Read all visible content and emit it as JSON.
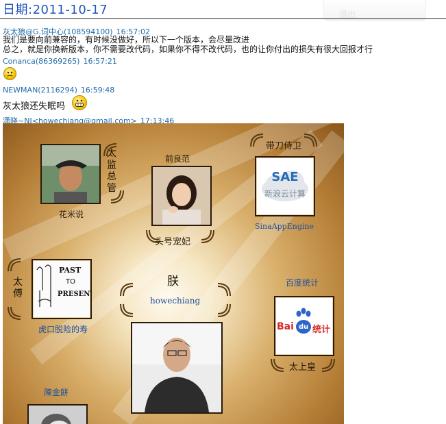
{
  "header": {
    "date_label": "日期:2011-10-17",
    "exit_button": "退出"
  },
  "messages": [
    {
      "sender": "灰太狼@G.词中心(108594100)",
      "time": "16:57:02",
      "lines": [
        "我们是要向前兼容的，有时候没做好，所以下一个版本，会尽量改进",
        "总之，就是你换新版本，你不需要改代码，如果你不得不改代码，也的让你付出的损失有很大回报才行"
      ]
    },
    {
      "sender": "Conanca(86369265)",
      "time": "16:57:21",
      "emoji": "thinking-face"
    },
    {
      "sender": "NEWMAN(2116294)",
      "time": "16:59:48",
      "text": "灰太狼还失眠吗",
      "emoji": "grinning-face"
    },
    {
      "sender": "潇晓~NJ<howechiang@gmail.com>",
      "time": "17:13:46"
    }
  ],
  "collage": {
    "labels": {
      "huamishuo": "花米说",
      "taijian": "太监总管",
      "qianliangfan": "前良范",
      "touhao": "头号宠妃",
      "daidao": "带刀侍卫",
      "sinaapp": "SinaAppEngine",
      "taifu": "太傅",
      "hukou": "虎口脱险的寿",
      "zhen": "朕",
      "howechiang": "howechiang",
      "baidutongji": "百度统计",
      "taishanghuang": "太上皇",
      "chenjinbing": "陳金餅"
    },
    "sae_logo": {
      "title": "SAE",
      "subtitle": "新浪云计算"
    },
    "baidu_logo": {
      "bai": "Bai",
      "du": "du",
      "tongji": "统计"
    },
    "sketch_text": [
      "PAST",
      "TO",
      "PRESENT"
    ]
  }
}
